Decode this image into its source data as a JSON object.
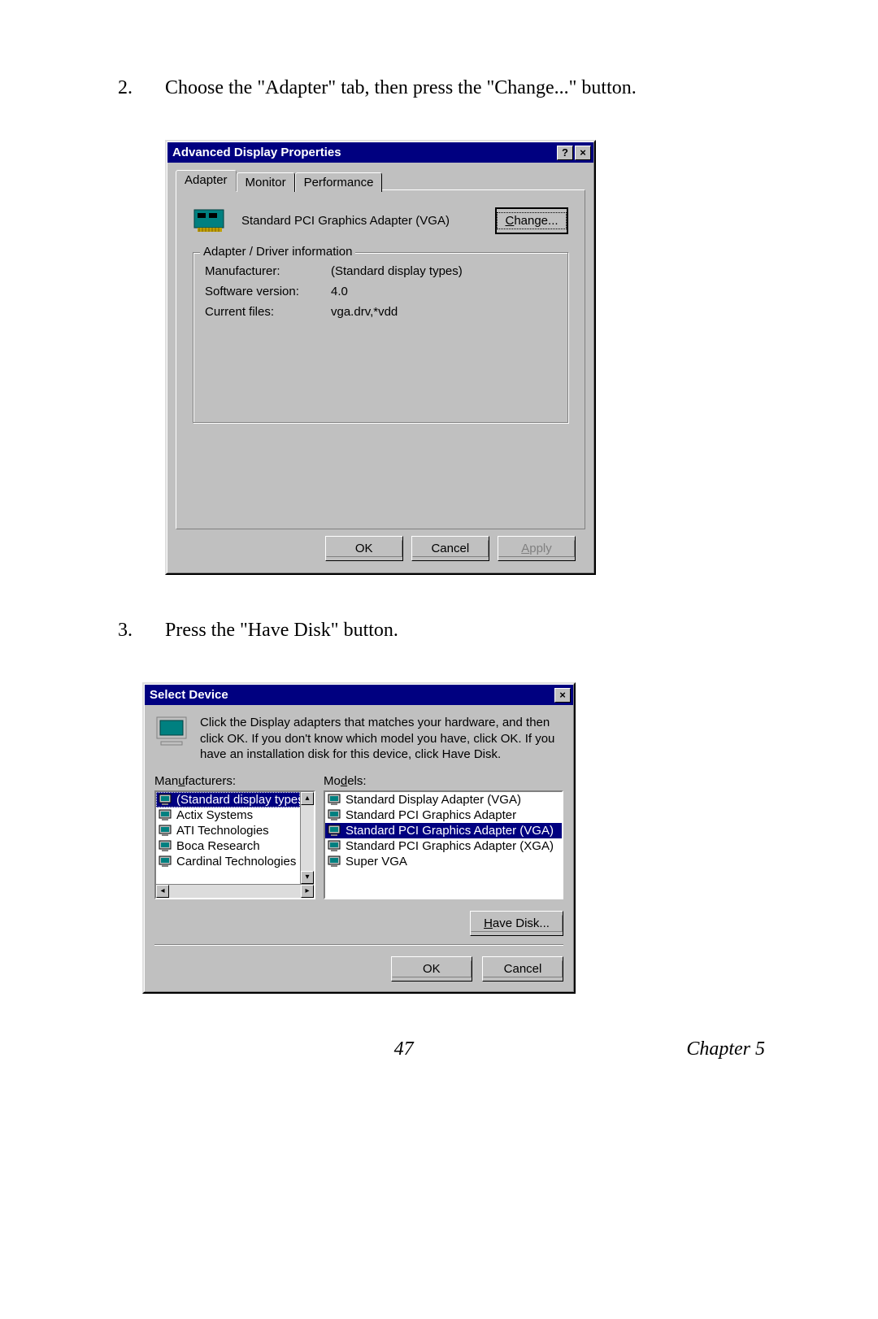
{
  "steps": {
    "s2": {
      "num": "2.",
      "text": "Choose the \"Adapter\" tab, then press the \"Change...\" button."
    },
    "s3": {
      "num": "3.",
      "text": "Press the \"Have Disk\" button."
    }
  },
  "dialog1": {
    "title": "Advanced Display Properties",
    "tabs": {
      "adapter": "Adapter",
      "monitor": "Monitor",
      "performance": "Performance"
    },
    "adapter_name": "Standard PCI Graphics Adapter (VGA)",
    "change_btn": "Change...",
    "groupbox_title": "Adapter / Driver information",
    "rows": {
      "manufacturer": {
        "label": "Manufacturer:",
        "value": "(Standard display types)"
      },
      "software": {
        "label": "Software version:",
        "value": "4.0"
      },
      "files": {
        "label": "Current files:",
        "value": "vga.drv,*vdd"
      }
    },
    "buttons": {
      "ok": "OK",
      "cancel": "Cancel",
      "apply": "Apply"
    }
  },
  "dialog2": {
    "title": "Select Device",
    "instruction": "Click the Display adapters that matches your hardware, and then click OK. If you don't know which model you have, click OK. If you have an installation disk for this device, click Have Disk.",
    "labels": {
      "manufacturers": "Manufacturers:",
      "models": "Models:"
    },
    "manufacturers": [
      "(Standard display types)",
      "Actix Systems",
      "ATI Technologies",
      "Boca Research",
      "Cardinal Technologies"
    ],
    "models": [
      "Standard Display Adapter (VGA)",
      "Standard PCI Graphics Adapter",
      "Standard PCI Graphics Adapter (VGA)",
      "Standard PCI Graphics Adapter (XGA)",
      "Super VGA"
    ],
    "buttons": {
      "havedisk": "Have Disk...",
      "ok": "OK",
      "cancel": "Cancel"
    }
  },
  "footer": {
    "page": "47",
    "chapter": "Chapter 5"
  }
}
